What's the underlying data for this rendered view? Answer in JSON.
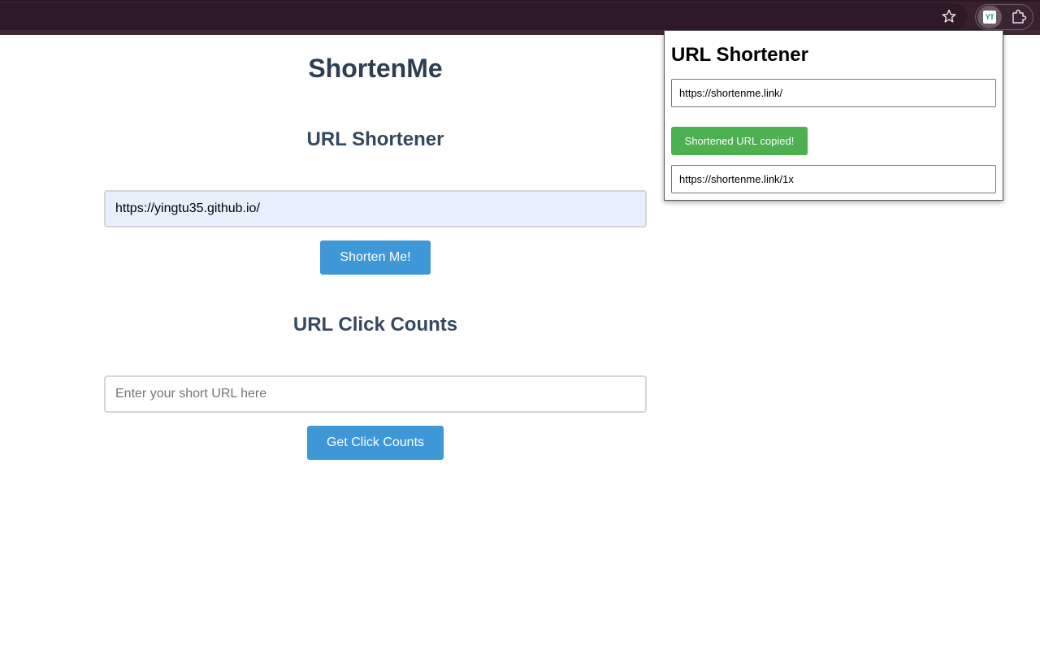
{
  "browser": {
    "extension_badge": "YT"
  },
  "main": {
    "title": "ShortenMe",
    "shortener": {
      "heading": "URL Shortener",
      "input_value": "https://yingtu35.github.io/",
      "button_label": "Shorten Me!"
    },
    "click_counts": {
      "heading": "URL Click Counts",
      "input_placeholder": "Enter your short URL here",
      "button_label": "Get Click Counts"
    }
  },
  "popup": {
    "title": "URL Shortener",
    "base_url_value": "https://shortenme.link/",
    "status_button_label": "Shortened URL copied!",
    "result_value": "https://shortenme.link/1x"
  },
  "colors": {
    "accent_blue": "#3e97d7",
    "success_green": "#4caf50",
    "heading_dark": "#2c3e50",
    "toolbar_bg": "#38202d"
  }
}
